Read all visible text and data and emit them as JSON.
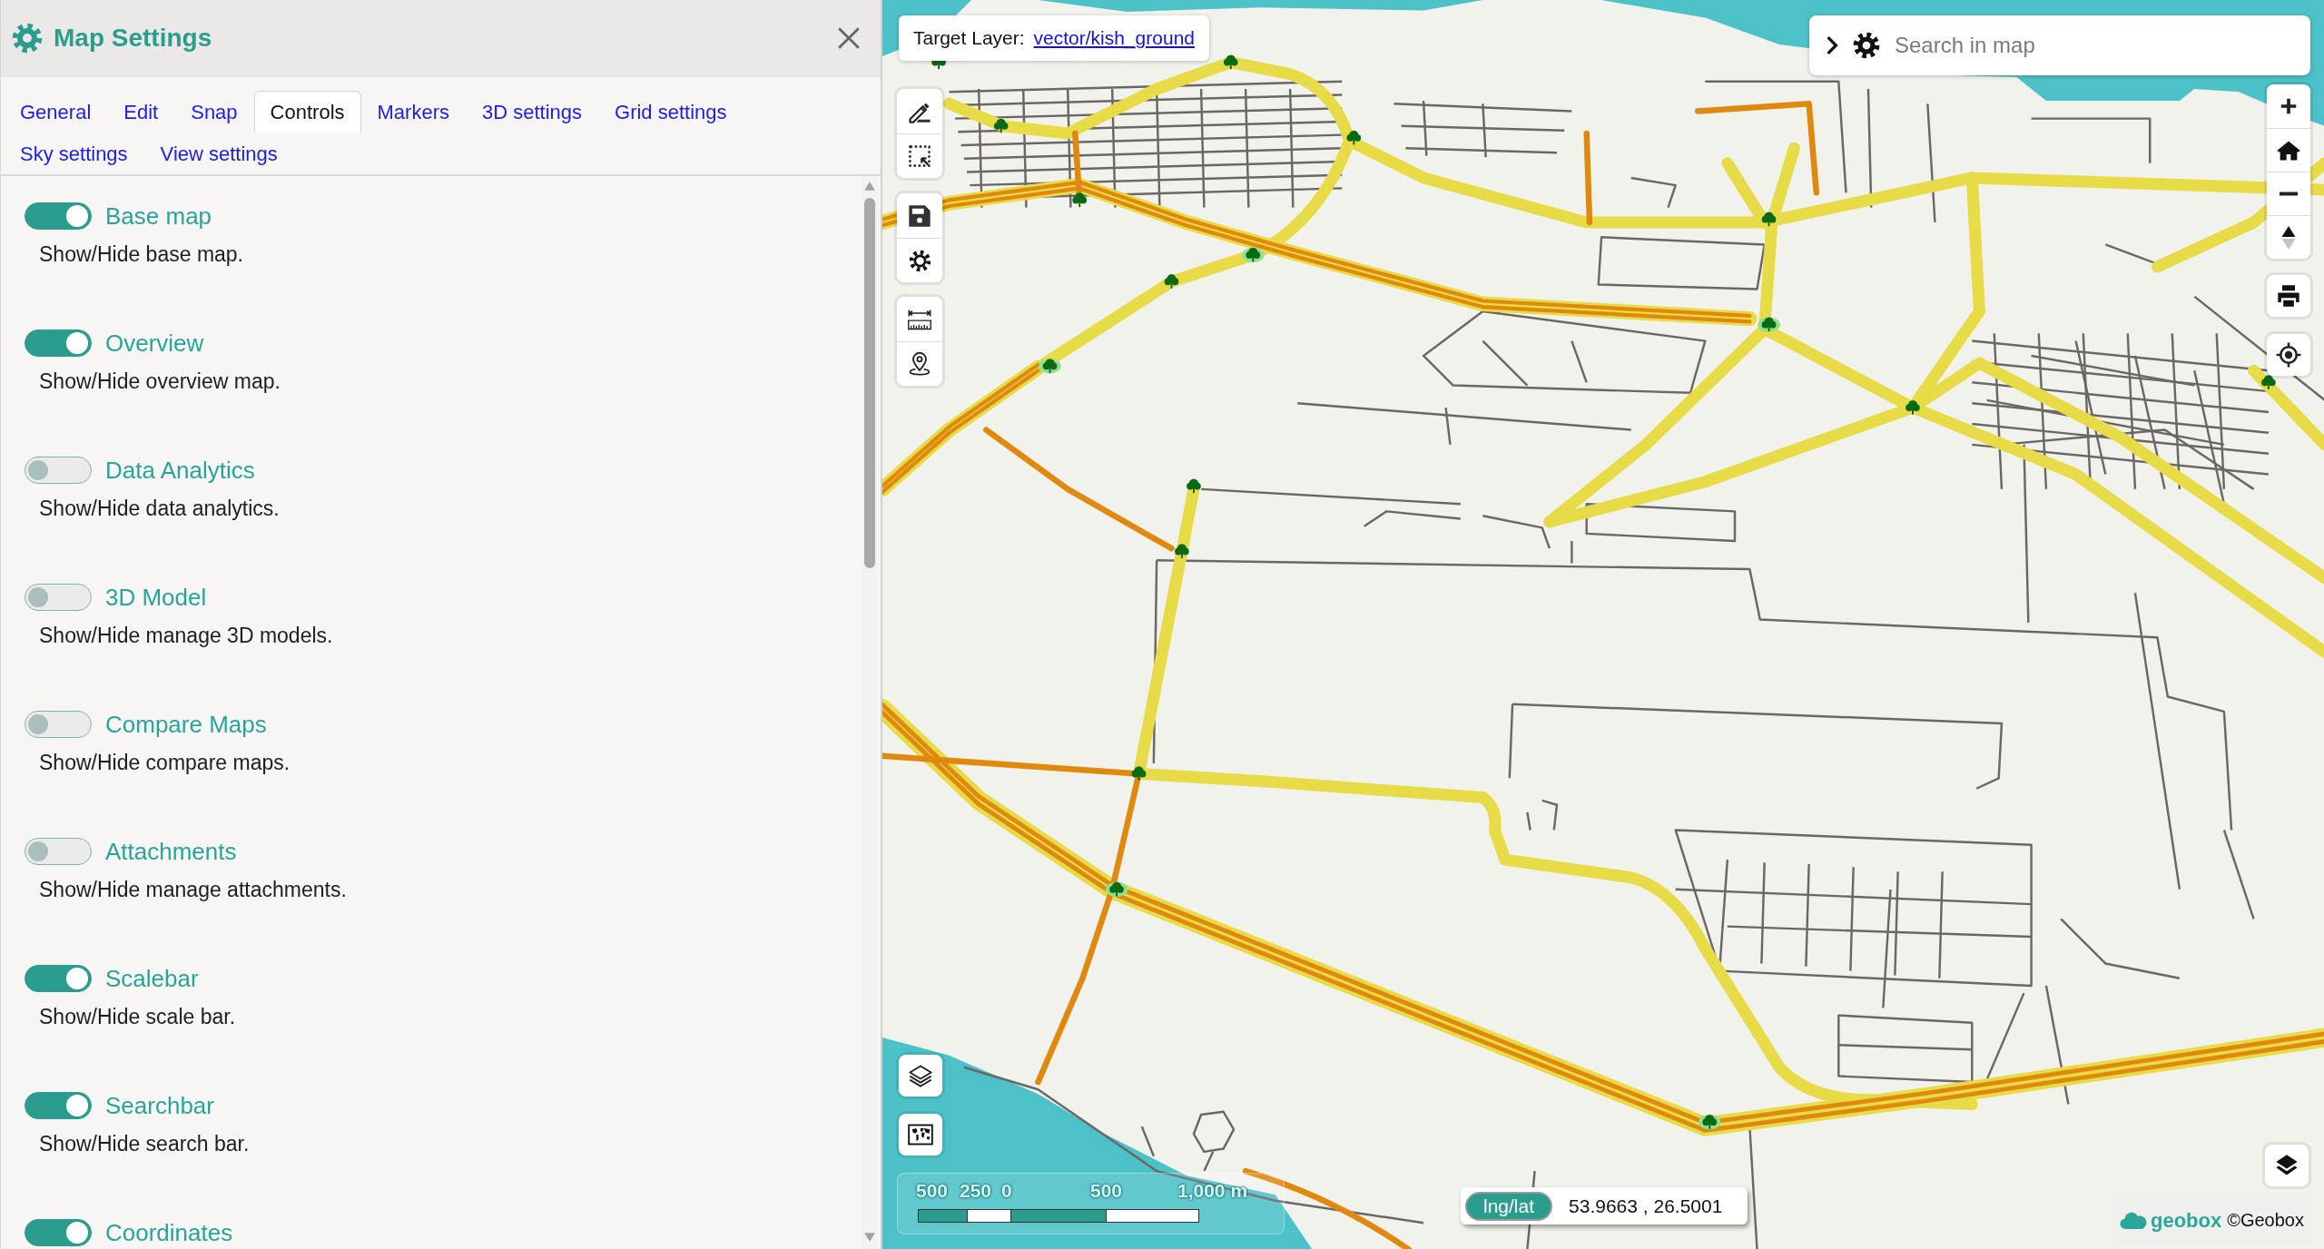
{
  "panel": {
    "title": "Map Settings"
  },
  "tabs": [
    {
      "label": "General",
      "selected": false
    },
    {
      "label": "Edit",
      "selected": false
    },
    {
      "label": "Snap",
      "selected": false
    },
    {
      "label": "Controls",
      "selected": true
    },
    {
      "label": "Markers",
      "selected": false
    },
    {
      "label": "3D settings",
      "selected": false
    },
    {
      "label": "Grid settings",
      "selected": false
    },
    {
      "label": "Sky settings",
      "selected": false
    },
    {
      "label": "View settings",
      "selected": false
    }
  ],
  "controls": [
    {
      "label": "Base map",
      "description": "Show/Hide base map.",
      "on": true
    },
    {
      "label": "Overview",
      "description": "Show/Hide overview map.",
      "on": true
    },
    {
      "label": "Data Analytics",
      "description": "Show/Hide data analytics.",
      "on": false
    },
    {
      "label": "3D Model",
      "description": "Show/Hide manage 3D models.",
      "on": false
    },
    {
      "label": "Compare Maps",
      "description": "Show/Hide compare maps.",
      "on": false
    },
    {
      "label": "Attachments",
      "description": "Show/Hide manage attachments.",
      "on": false
    },
    {
      "label": "Scalebar",
      "description": "Show/Hide scale bar.",
      "on": true
    },
    {
      "label": "Searchbar",
      "description": "Show/Hide search bar.",
      "on": true
    },
    {
      "label": "Coordinates",
      "on": true
    }
  ],
  "map": {
    "target_layer": {
      "label": "Target Layer:",
      "value": "vector/kish_ground"
    },
    "search": {
      "placeholder": "Search in map"
    },
    "scale_bar": {
      "labels": [
        "500",
        "250",
        "0",
        "500",
        "1,000 m"
      ]
    },
    "coordinates": {
      "format": "lng/lat",
      "value": "53.9663 , 26.5001"
    },
    "attribution": {
      "logo": "geobox",
      "text": "©Geobox"
    }
  }
}
